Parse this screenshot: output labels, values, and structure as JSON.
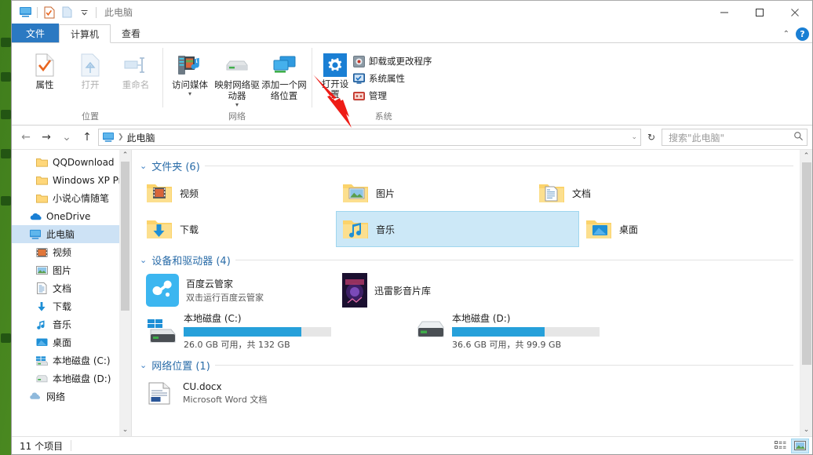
{
  "window": {
    "title": "此电脑",
    "controls": {
      "minimize": "—",
      "maximize": "□",
      "close": "✕"
    },
    "ribbon_collapse": "⌃",
    "help": "?"
  },
  "quick_access": {
    "items": [
      {
        "name": "this-pc-icon",
        "label": "此电脑"
      },
      {
        "name": "properties-icon",
        "label": "属性"
      },
      {
        "name": "new-folder-icon",
        "label": "新建文件夹"
      },
      {
        "name": "customize-caret",
        "label": "自定义快速访问工具栏"
      }
    ]
  },
  "tabs": [
    {
      "id": "file",
      "label": "文件"
    },
    {
      "id": "computer",
      "label": "计算机"
    },
    {
      "id": "view",
      "label": "查看"
    }
  ],
  "ribbon": {
    "groups": [
      {
        "label": "位置",
        "big_buttons": [
          {
            "name": "properties-button",
            "label": "属性",
            "icon": "document-check-icon",
            "disabled": false
          },
          {
            "name": "open-button",
            "label": "打开",
            "icon": "open-file-icon",
            "disabled": true
          },
          {
            "name": "rename-button",
            "label": "重命名",
            "icon": "rename-icon",
            "disabled": true
          }
        ]
      },
      {
        "label": "网络",
        "big_buttons": [
          {
            "name": "access-media-button",
            "label": "访问媒体",
            "icon": "media-server-icon",
            "has_caret": true
          },
          {
            "name": "map-network-drive-button",
            "label": "映射网络驱动器",
            "icon": "network-drive-icon",
            "has_caret": true
          },
          {
            "name": "add-network-location-button",
            "label": "添加一个网络位置",
            "icon": "add-network-icon",
            "has_caret": false
          }
        ]
      },
      {
        "label": "系统",
        "big_buttons": [
          {
            "name": "open-settings-button",
            "label": "打开设置",
            "icon": "gear-icon",
            "has_caret": false
          }
        ],
        "small_buttons": [
          {
            "name": "uninstall-change-program-button",
            "label": "卸载或更改程序",
            "icon": "uninstall-icon"
          },
          {
            "name": "system-properties-button",
            "label": "系统属性",
            "icon": "system-properties-icon"
          },
          {
            "name": "manage-button",
            "label": "管理",
            "icon": "manage-icon"
          }
        ]
      }
    ]
  },
  "address": {
    "back": "←",
    "forward": "→",
    "recent": "⌄",
    "up": "↑",
    "crumb_icon": "this-pc-icon",
    "crumb": "此电脑",
    "crumb_caret": "⌄",
    "refresh": "↻",
    "search_placeholder": "搜索\"此电脑\"",
    "search_value": ""
  },
  "sidebar": {
    "items": [
      {
        "label": "QQDownload",
        "icon": "folder-icon",
        "level": 2,
        "selected": false
      },
      {
        "label": "Windows XP Pr",
        "icon": "folder-icon",
        "level": 2,
        "selected": false
      },
      {
        "label": "小说心情随笔",
        "icon": "folder-icon",
        "level": 2,
        "selected": false
      },
      {
        "label": "OneDrive",
        "icon": "onedrive-icon",
        "level": 1,
        "selected": false
      },
      {
        "label": "此电脑",
        "icon": "this-pc-icon",
        "level": 1,
        "selected": true
      },
      {
        "label": "视频",
        "icon": "videos-icon",
        "level": 2,
        "selected": false
      },
      {
        "label": "图片",
        "icon": "pictures-icon",
        "level": 2,
        "selected": false
      },
      {
        "label": "文档",
        "icon": "documents-icon",
        "level": 2,
        "selected": false
      },
      {
        "label": "下载",
        "icon": "downloads-icon",
        "level": 2,
        "selected": false
      },
      {
        "label": "音乐",
        "icon": "music-icon",
        "level": 2,
        "selected": false
      },
      {
        "label": "桌面",
        "icon": "desktop-icon",
        "level": 2,
        "selected": false
      },
      {
        "label": "本地磁盘 (C:)",
        "icon": "windows-drive-icon",
        "level": 2,
        "selected": false
      },
      {
        "label": "本地磁盘 (D:)",
        "icon": "drive-icon",
        "level": 2,
        "selected": false
      },
      {
        "label": "网络",
        "icon": "network-icon",
        "level": 1,
        "selected": false
      }
    ],
    "scroll_up": "⌃",
    "scroll_down": "⌄"
  },
  "main": {
    "sections": [
      {
        "id": "folders",
        "caret": "⌄",
        "title": "文件夹 (6)",
        "items": [
          {
            "label": "视频",
            "icon": "folder-videos-icon",
            "selected": false
          },
          {
            "label": "图片",
            "icon": "folder-pictures-icon",
            "selected": false
          },
          {
            "label": "文档",
            "icon": "folder-documents-icon",
            "selected": false
          },
          {
            "label": "下载",
            "icon": "folder-downloads-icon",
            "selected": false
          },
          {
            "label": "音乐",
            "icon": "folder-music-icon",
            "selected": true
          },
          {
            "label": "桌面",
            "icon": "folder-desktop-icon",
            "selected": false
          }
        ]
      },
      {
        "id": "devices",
        "caret": "⌄",
        "title": "设备和驱动器 (4)",
        "items": [
          {
            "label": "百度云管家",
            "sublabel": "双击运行百度云管家",
            "icon": "baidu-cloud-icon",
            "type": "app"
          },
          {
            "label": "迅雷影音片库",
            "sublabel": "",
            "icon": "thunder-video-icon",
            "type": "app"
          },
          {
            "label": "本地磁盘 (C:)",
            "icon": "windows-drive-icon",
            "type": "drive",
            "free": "26.0 GB",
            "total": "132 GB",
            "info": "26.0 GB 可用，共 132 GB",
            "used_percent": 80
          },
          {
            "label": "本地磁盘 (D:)",
            "icon": "drive-icon",
            "type": "drive",
            "free": "36.6 GB",
            "total": "99.9 GB",
            "info": "36.6 GB 可用，共 99.9 GB",
            "used_percent": 63
          }
        ]
      },
      {
        "id": "network-locations",
        "caret": "⌄",
        "title": "网络位置 (1)",
        "items": [
          {
            "label": "CU.docx",
            "sublabel": "Microsoft Word 文档",
            "icon": "word-document-icon"
          }
        ]
      }
    ]
  },
  "status": {
    "item_count": "11 个项目",
    "views": [
      {
        "name": "details-view-button",
        "active": false
      },
      {
        "name": "large-icons-view-button",
        "active": true
      }
    ]
  },
  "annotation": {
    "arrow_color": "#ee1c16",
    "points_to": "系统属性"
  },
  "colors": {
    "accent": "#2b79c2",
    "selection": "#cce8f7",
    "drive_bar": "#26a0da",
    "group_heading": "#2a6ca8"
  }
}
